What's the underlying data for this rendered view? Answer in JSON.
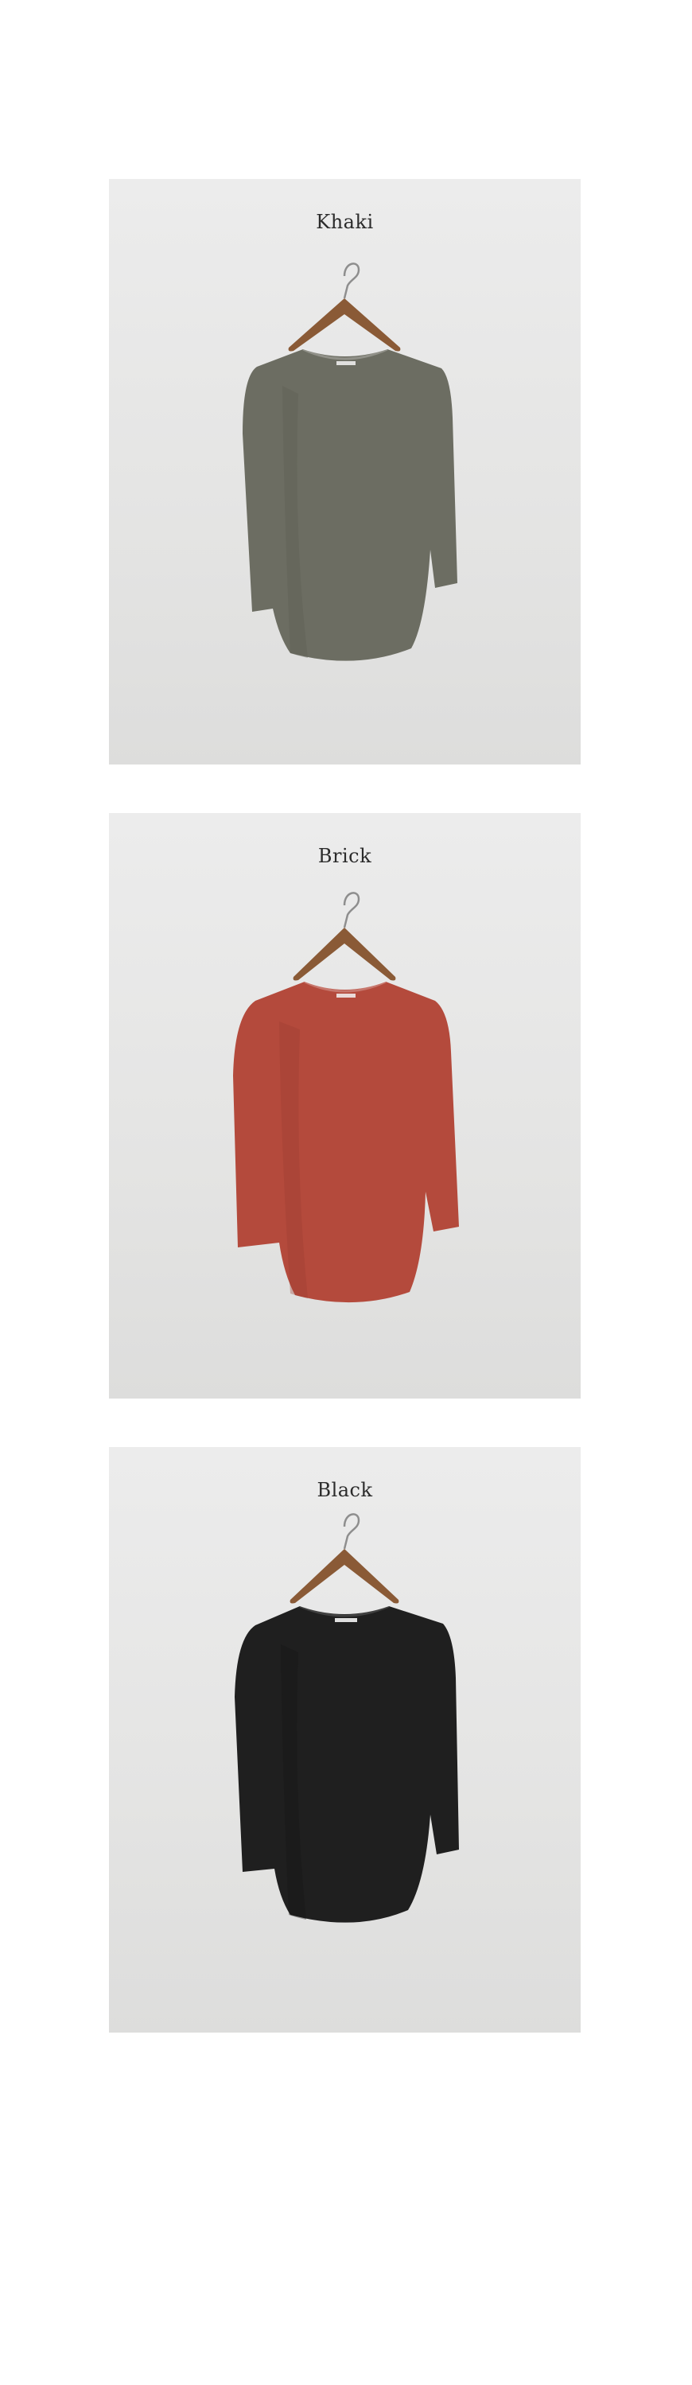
{
  "products": [
    {
      "label": "Khaki",
      "color": "#6c6d62",
      "shade": "#5b5c52"
    },
    {
      "label": "Brick",
      "color": "#b44a3c",
      "shade": "#9c3c30"
    },
    {
      "label": "Black",
      "color": "#1f1f1f",
      "shade": "#141414"
    }
  ],
  "hanger": {
    "wood": "#8a5a36",
    "hook": "#8e8e8e"
  }
}
